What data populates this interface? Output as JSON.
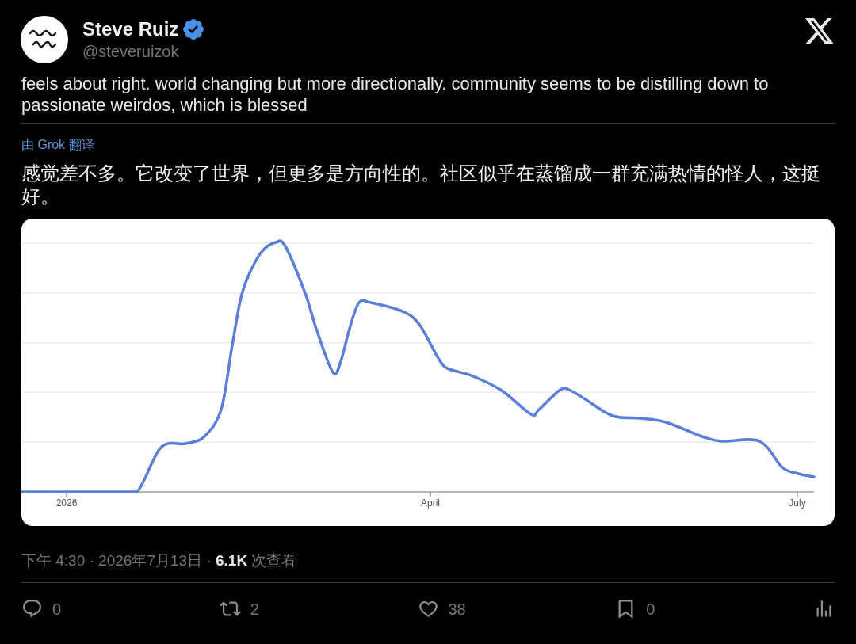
{
  "author": {
    "name": "Steve Ruiz",
    "verified": true,
    "handle": "@steveruizok"
  },
  "tweet": {
    "text": "feels about right. world changing but more directionally. community seems to be distilling down to passionate weirdos, which is blessed",
    "translation_label": "由 Grok 翻译",
    "translation": "感觉差不多。它改变了世界，但更多是方向性的。社区似乎在蒸馏成一群充满热情的怪人，这挺好。"
  },
  "chart": {
    "x_axis_labels": [
      "2026",
      "April",
      "July"
    ]
  },
  "meta": "下午 4:30 · 2026年7月13日 · **6.1K** 次查看",
  "actions": [
    {
      "kind": "reply",
      "count": "0"
    },
    {
      "kind": "repost",
      "count": "2"
    },
    {
      "kind": "like",
      "count": "38"
    },
    {
      "kind": "bookmark",
      "count": "0"
    },
    {
      "kind": "views"
    }
  ]
}
